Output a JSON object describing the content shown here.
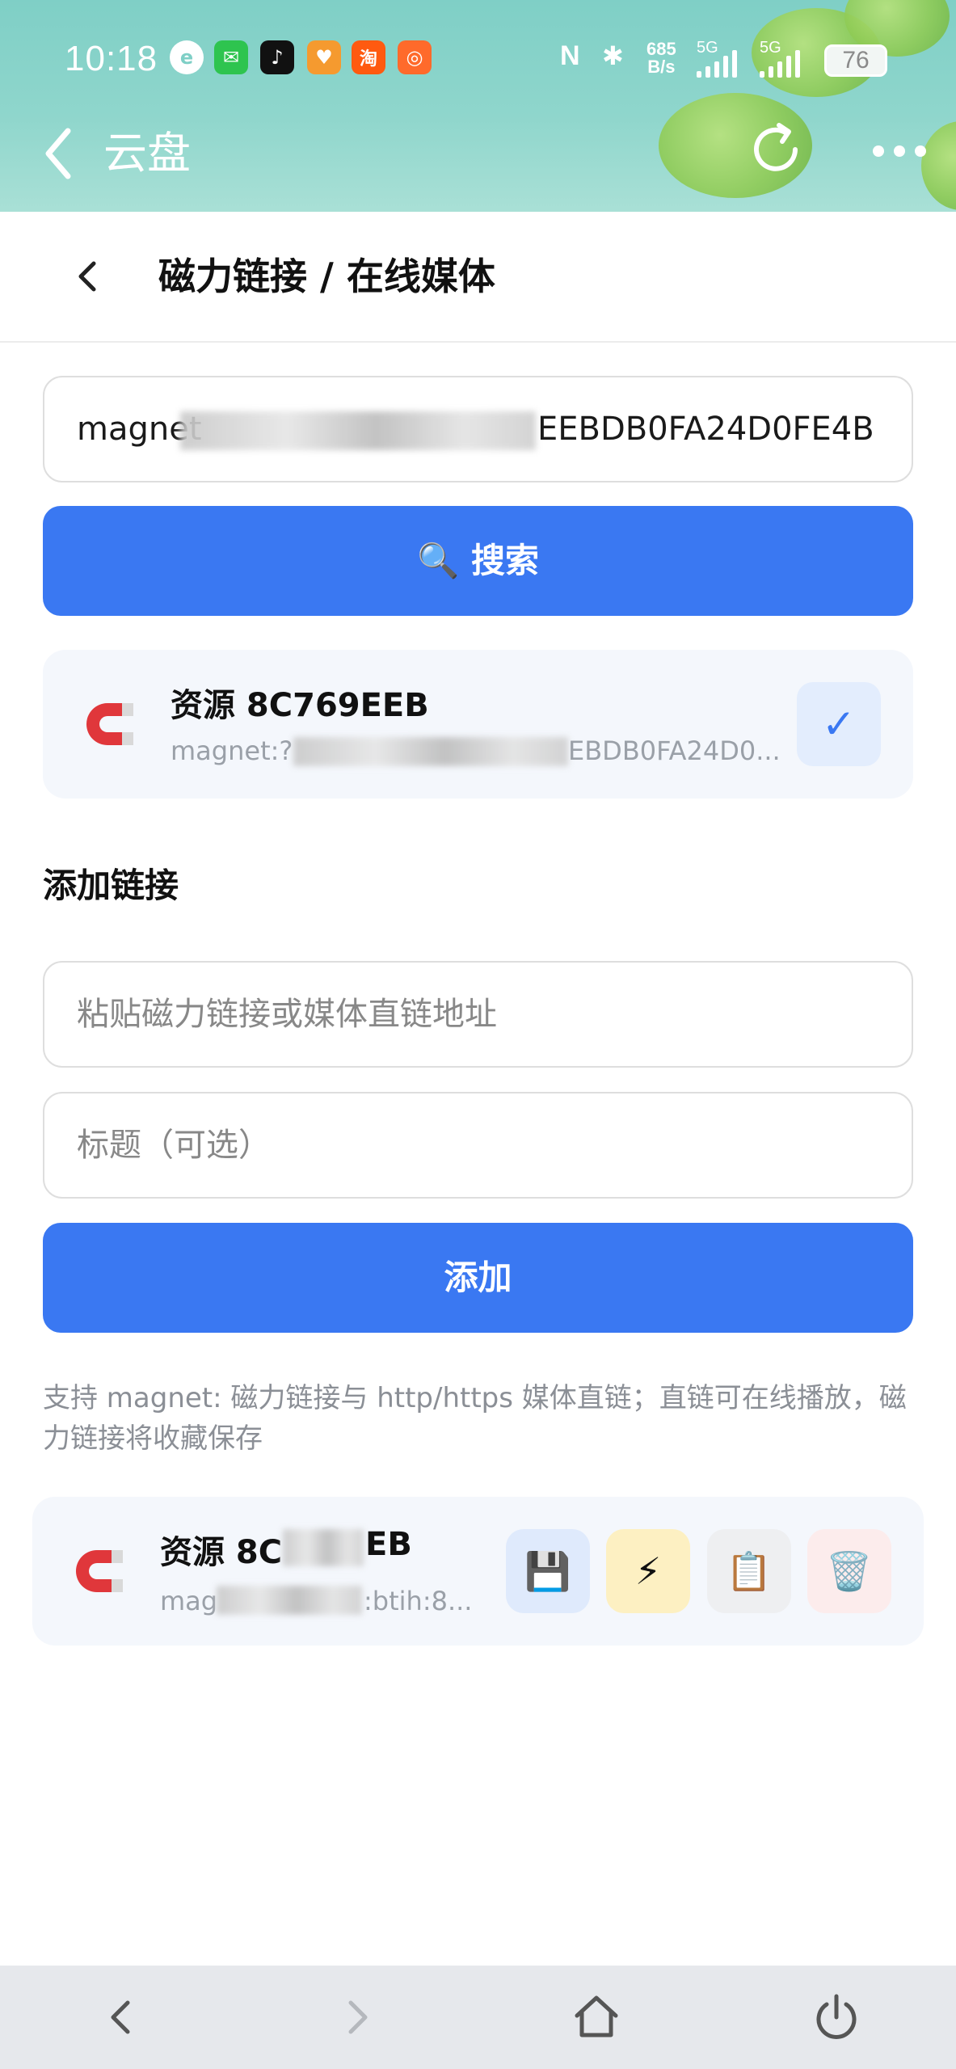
{
  "status_bar": {
    "time": "10:18",
    "net_speed_top": "685",
    "net_speed_bottom": "B/s",
    "sim1": "5G",
    "sim2": "5G",
    "battery": "76",
    "app_icons": [
      "qq-browser-icon",
      "wechat-icon",
      "tiktok-icon",
      "taobao-heart-icon",
      "taobao-icon",
      "kuaishou-icon"
    ]
  },
  "app_bar": {
    "title": "云盘"
  },
  "page": {
    "title": "磁力链接 / 在线媒体",
    "search_input_value_start": "magnet",
    "search_input_value_end": "EEBDB0FA24D0FE4B",
    "search_button": "🔍 搜索"
  },
  "search_result": {
    "title": "资源 8C769EEB",
    "subtitle_start": "magnet:?x",
    "subtitle_end": "EBDB0FA24D0...",
    "check_mark": "✓"
  },
  "add_section": {
    "heading": "添加链接",
    "link_placeholder": "粘贴磁力链接或媒体直链地址",
    "title_placeholder": "标题（可选）",
    "add_button": "添加",
    "hint": "支持 magnet: 磁力链接与 http/https 媒体直链；直链可在线播放，磁力链接将收藏保存"
  },
  "saved_item": {
    "title_start": "资源 8C",
    "title_end": "EB",
    "subtitle_start": "mag",
    "subtitle_end": ":btih:8...",
    "actions": [
      {
        "icon": "💾",
        "name": "save"
      },
      {
        "icon": "⚡",
        "name": "play"
      },
      {
        "icon": "📋",
        "name": "copy"
      },
      {
        "icon": "🗑️",
        "name": "delete"
      }
    ]
  },
  "colors": {
    "primary": "#3a78f2",
    "card_bg": "#f4f7fc",
    "header_teal": "#8fd6cc"
  }
}
